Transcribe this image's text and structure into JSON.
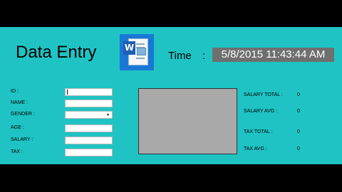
{
  "header": {
    "title": "Data Entry",
    "icon_letter": "W",
    "time_label": "Time",
    "time_colon": ":",
    "time_value": "5/8/2015 11:43:44 AM"
  },
  "form": {
    "id_label": "ID :",
    "name_label": "NAME :",
    "gender_label": "GENDER :",
    "age_label": "AGE :",
    "salary_label": "SALARY :",
    "tax_label": "TAX :"
  },
  "stats": {
    "salary_total_label": "SALARY TOTAL :",
    "salary_total_value": "0",
    "salary_avg_label": "SALARY AVG :",
    "salary_avg_value": "0",
    "tax_total_label": "TAX TOTAL :",
    "tax_total_value": "0",
    "tax_avg_label": "TAX AVG :",
    "tax_avg_value": "0"
  },
  "colors": {
    "background": "#1fc3c3",
    "frame": "#000000",
    "time_box": "#6f6f6f",
    "display_box": "#a9a9a9"
  },
  "icons": [
    "word-document-icon",
    "dropdown-arrow-icon"
  ]
}
